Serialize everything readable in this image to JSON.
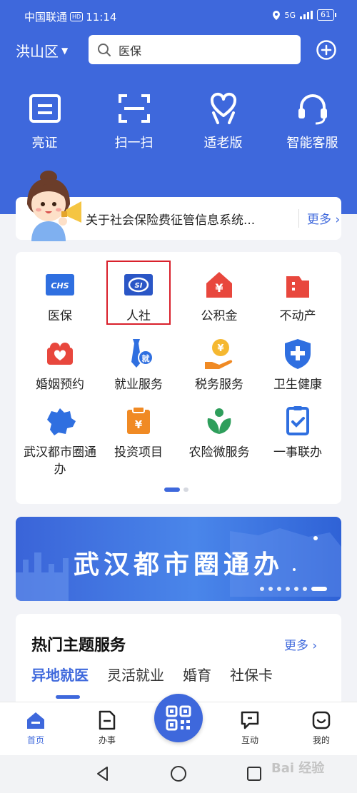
{
  "status_bar": {
    "carrier": "中国联通",
    "hd": "HD",
    "time": "11:14",
    "network": "5G",
    "battery": "61"
  },
  "header": {
    "region": "洪山区",
    "search_value": "医保"
  },
  "quick_actions": [
    {
      "label": "亮证",
      "icon": "id-card-icon"
    },
    {
      "label": "扫一扫",
      "icon": "scan-icon"
    },
    {
      "label": "适老版",
      "icon": "elderly-heart-icon"
    },
    {
      "label": "智能客服",
      "icon": "headset-icon"
    }
  ],
  "notice": {
    "text": "关于社会保险费征管信息系统...",
    "more": "更多"
  },
  "services": [
    {
      "label": "医保",
      "icon": "chs-icon",
      "badge": "CHS"
    },
    {
      "label": "人社",
      "icon": "social-insurance-icon",
      "badge": "SI"
    },
    {
      "label": "公积金",
      "icon": "housing-fund-icon",
      "badge": "¥"
    },
    {
      "label": "不动产",
      "icon": "real-estate-icon"
    },
    {
      "label": "婚姻预约",
      "icon": "marriage-icon"
    },
    {
      "label": "就业服务",
      "icon": "employment-icon",
      "badge": "就"
    },
    {
      "label": "税务服务",
      "icon": "tax-icon",
      "badge": "¥"
    },
    {
      "label": "卫生健康",
      "icon": "health-icon"
    },
    {
      "label": "武汉都市圈通办",
      "icon": "map-icon"
    },
    {
      "label": "投资项目",
      "icon": "investment-icon",
      "badge": "¥"
    },
    {
      "label": "农险微服务",
      "icon": "sprout-icon"
    },
    {
      "label": "一事联办",
      "icon": "checklist-icon"
    }
  ],
  "banner": {
    "title": "武汉都市圈通办"
  },
  "hot": {
    "title": "热门主题服务",
    "more": "更多",
    "tabs": [
      "异地就医",
      "灵活就业",
      "婚育",
      "社保卡"
    ]
  },
  "bottom_nav": [
    {
      "label": "首页",
      "icon": "home-icon"
    },
    {
      "label": "办事",
      "icon": "document-icon"
    },
    {
      "label": "互动",
      "icon": "chat-icon"
    },
    {
      "label": "我的",
      "icon": "smile-icon"
    }
  ],
  "watermark": "Bai 经验",
  "colors": {
    "primary": "#3e68dc",
    "highlight": "#d9202b",
    "orange": "#f08a24",
    "red": "#e8473d",
    "green": "#2e9e5b"
  }
}
